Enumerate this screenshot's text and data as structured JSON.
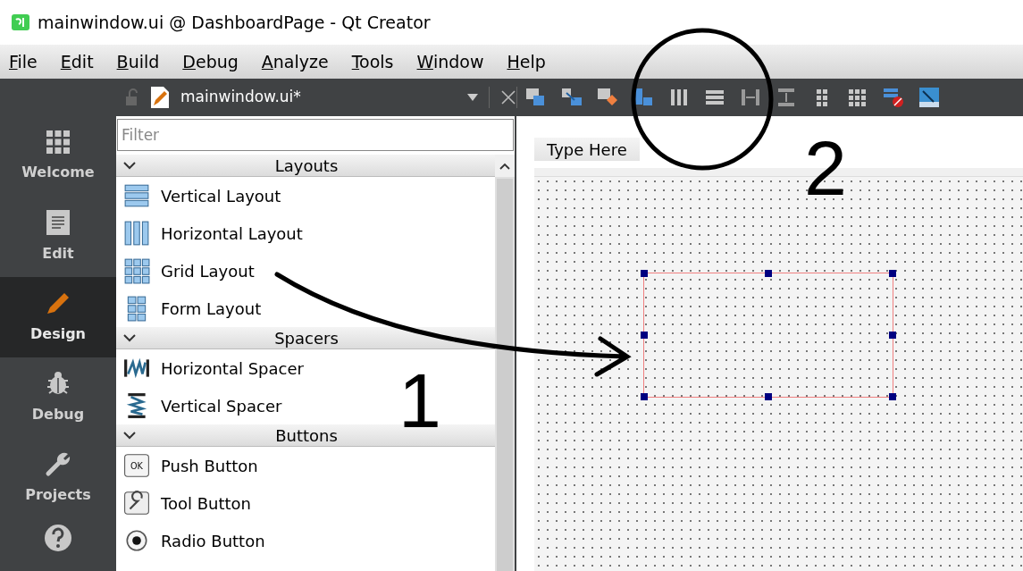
{
  "window": {
    "title": "mainwindow.ui @ DashboardPage - Qt Creator"
  },
  "menu_bar": [
    "File",
    "Edit",
    "Build",
    "Debug",
    "Analyze",
    "Tools",
    "Window",
    "Help"
  ],
  "editor_toolbar": {
    "document": "mainwindow.ui*"
  },
  "mode_bar": [
    {
      "label": "Welcome",
      "selected": false
    },
    {
      "label": "Edit",
      "selected": false
    },
    {
      "label": "Design",
      "selected": true
    },
    {
      "label": "Debug",
      "selected": false
    },
    {
      "label": "Projects",
      "selected": false
    }
  ],
  "widget_box": {
    "filter": {
      "placeholder": "Filter"
    },
    "sections": [
      {
        "title": "Layouts",
        "expanded": true,
        "items": [
          "Vertical Layout",
          "Horizontal Layout",
          "Grid Layout",
          "Form Layout"
        ]
      },
      {
        "title": "Spacers",
        "expanded": true,
        "items": [
          "Horizontal Spacer",
          "Vertical Spacer"
        ]
      },
      {
        "title": "Buttons",
        "expanded": true,
        "items": [
          "Push Button",
          "Tool Button",
          "Radio Button"
        ]
      }
    ],
    "push_button_icon_text": "OK"
  },
  "form_editor": {
    "menu_placeholder": "Type Here"
  },
  "annotations": [
    "1",
    "2"
  ]
}
